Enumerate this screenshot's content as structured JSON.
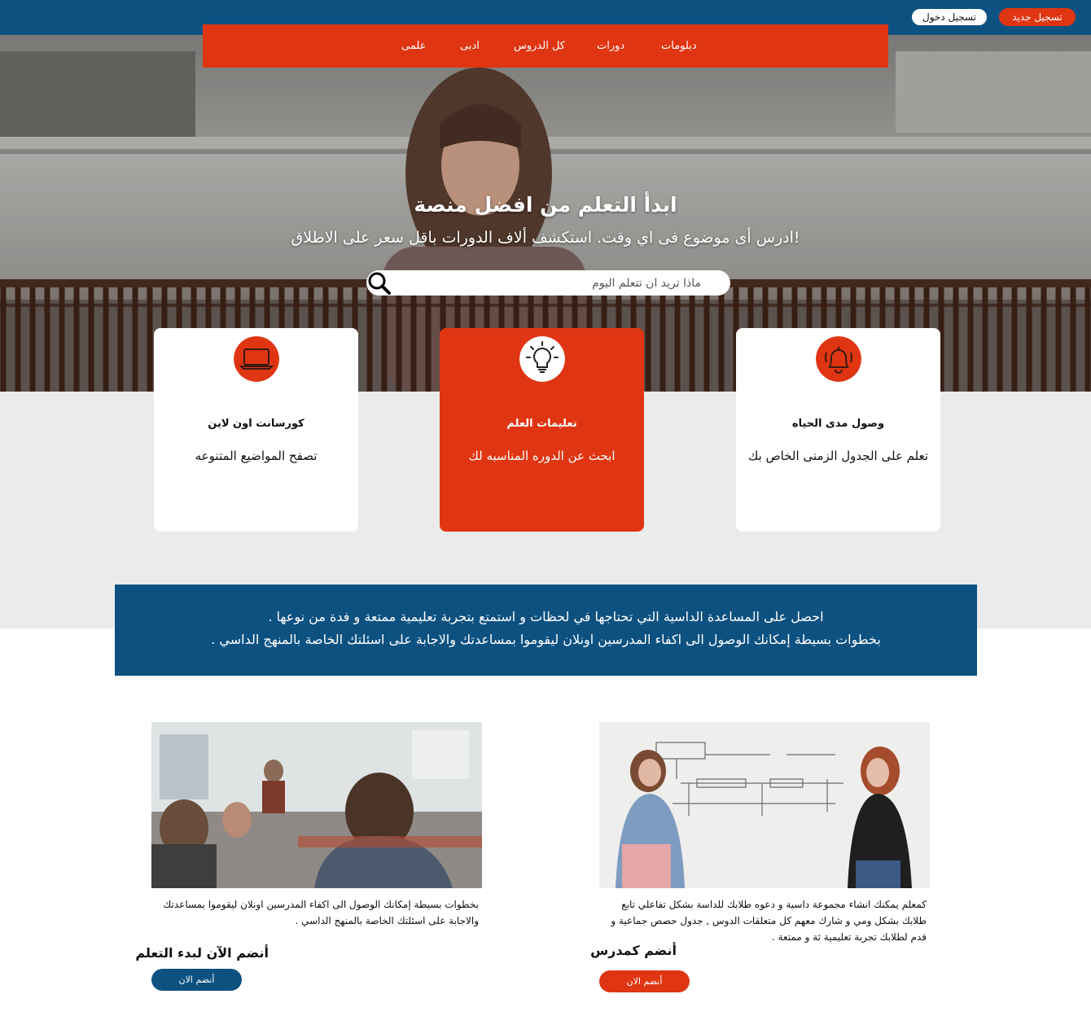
{
  "header": {
    "register_label": "تسجيل جديد",
    "login_label": "تسجيل دخول"
  },
  "nav": {
    "items": [
      "دبلومات",
      "دورات",
      "كل الدروس",
      "ادبى",
      "علمى"
    ]
  },
  "hero": {
    "title": "ابدأ التعلم من افضل منصة",
    "subtitle": "ادرس أى موضوع فى اي وقت. استكشف ألاف الدورات باقل سعر على الاطلاق!",
    "search_placeholder": "ماذا تريد ان تتعلم اليوم"
  },
  "features": [
    {
      "icon": "laptop-icon",
      "title": "كورسانت اون لاين",
      "text": "تصفح المواضيع المتنوعه",
      "active": false
    },
    {
      "icon": "lightbulb-icon",
      "title": "تعليمات العلم",
      "text": "ابحث عن الدوره المناسبه لك",
      "active": true
    },
    {
      "icon": "bell-icon",
      "title": "وصول مدى الحياه",
      "text": "تعلم على الجدول الزمنى الخاص بك",
      "active": false
    }
  ],
  "banner": {
    "line1": "احصل على المساعدة الداسية التي تحتاجها في لحظات و استمتع بتجربة تعليمية ممتعة و فدة من نوعها .",
    "line2": "بخطوات بسيطة إمكانك الوصول الى اكفاء المدرسين اونلان ليقوموا بمساعدتك والاجابة على اسئلتك الخاصة بالمنهج الداسي ."
  },
  "students": {
    "text": "بخطوات بسيطة إمكانك الوصول الى اكفاء المدرسين اونلان ليقوموا بمساعدتك والاجابة على اسئلتك الخاصة بالمنهج الداسي .",
    "heading": "أنضم الآن لبدء التعلم",
    "button": "أنضم الان"
  },
  "teachers": {
    "text": "كمعلم يمكنك انشاء مجموعة داسية و دعوه طلابك للداسة بشكل تفاعلي تابع طلابك بشكل ومي و شارك معهم كل متعلقات الدوس , جدول حصص جماعية و قدم لطلابك تجربة تعليمية ثة و ممتعة .",
    "heading": "أنضم كمدرس",
    "button": "أنضم الان"
  },
  "colors": {
    "primary_blue": "#0d5180",
    "accent_red": "#e03512",
    "grey_band": "#ebebeb"
  }
}
